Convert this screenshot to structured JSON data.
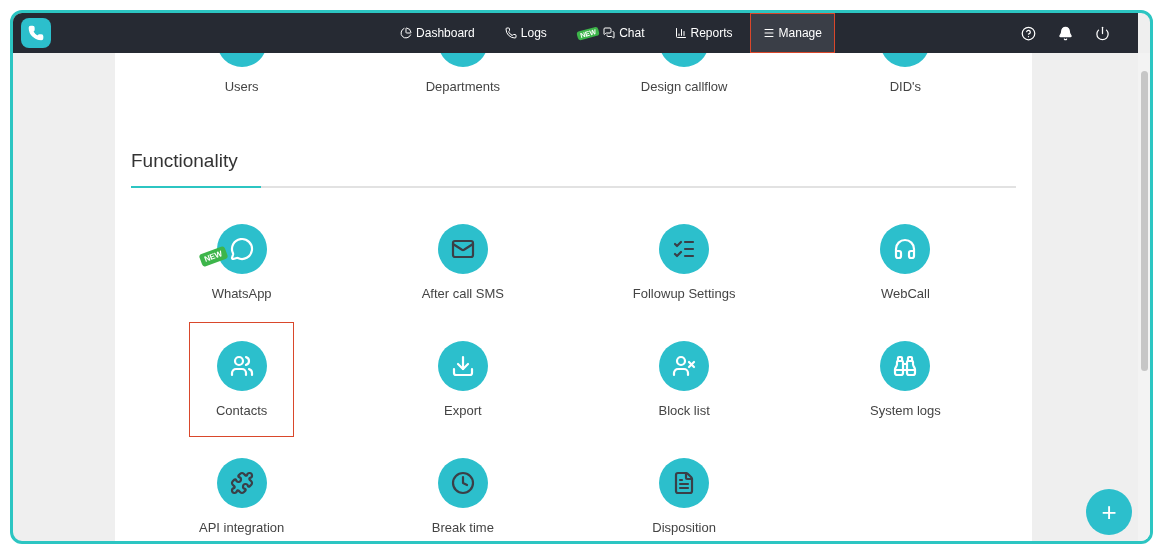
{
  "navbar": {
    "items": [
      {
        "label": "Dashboard",
        "selected": false,
        "highlighted": false
      },
      {
        "label": "Logs",
        "selected": false,
        "highlighted": false
      },
      {
        "label": "Chat",
        "badge": "NEW",
        "selected": false,
        "highlighted": false
      },
      {
        "label": "Reports",
        "selected": false,
        "highlighted": false
      },
      {
        "label": "Manage",
        "selected": true,
        "highlighted": true
      }
    ]
  },
  "top_tiles": [
    {
      "label": "Users"
    },
    {
      "label": "Departments"
    },
    {
      "label": "Design callflow"
    },
    {
      "label": "DID's"
    }
  ],
  "section": {
    "title": "Functionality",
    "tiles": [
      {
        "label": "WhatsApp",
        "badge": "NEW",
        "highlighted": false
      },
      {
        "label": "After call SMS",
        "highlighted": false
      },
      {
        "label": "Followup Settings",
        "highlighted": false
      },
      {
        "label": "WebCall",
        "highlighted": false
      },
      {
        "label": "Contacts",
        "highlighted": true
      },
      {
        "label": "Export",
        "highlighted": false
      },
      {
        "label": "Block list",
        "highlighted": false
      },
      {
        "label": "System logs",
        "highlighted": false
      },
      {
        "label": "API integration",
        "highlighted": false
      },
      {
        "label": "Break time",
        "highlighted": false
      },
      {
        "label": "Disposition",
        "highlighted": false
      }
    ]
  },
  "fab": {
    "label": "+"
  }
}
